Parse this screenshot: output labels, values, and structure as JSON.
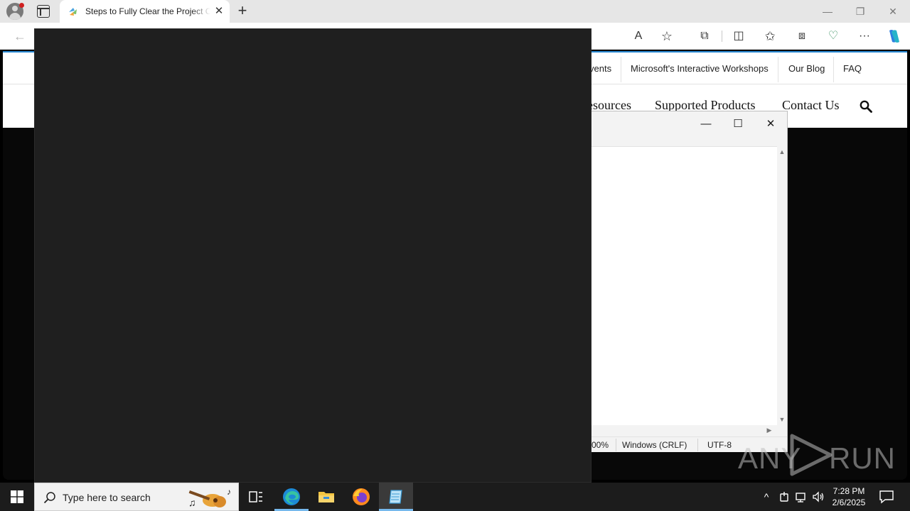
{
  "browser": {
    "tab": {
      "title": "Steps to Fully Clear the Project Cache",
      "close_glyph": "✕"
    },
    "new_tab_glyph": "+",
    "window_controls": {
      "minimize": "—",
      "restore": "❐",
      "close": "✕"
    },
    "toolbar": {
      "back_glyph": "←",
      "read_aloud_glyph": "A",
      "favorite_glyph": "☆",
      "extensions_glyph": "⧉",
      "split_glyph": "◫",
      "favorites_glyph": "✩",
      "collections_glyph": "⧈",
      "performance_glyph": "♡",
      "more_glyph": "···"
    },
    "accent_color": "#2a8ad4"
  },
  "website": {
    "top_nav": [
      "vents",
      "Microsoft's Interactive Workshops",
      "Our Blog",
      "FAQ"
    ],
    "main_nav": [
      "esources",
      "Supported Products",
      "Contact Us"
    ]
  },
  "notepad": {
    "controls": {
      "minimize": "—",
      "maximize": "☐",
      "close": "✕"
    },
    "status": {
      "zoom": "00%",
      "line_ending": "Windows (CRLF)",
      "encoding": "UTF-8"
    }
  },
  "watermark": {
    "left": "ANY",
    "right": "RUN"
  },
  "taskbar": {
    "search_placeholder": "Type here to search",
    "clock": {
      "time": "7:28 PM",
      "date": "2/6/2025"
    },
    "tray": {
      "chevron": "^"
    }
  }
}
